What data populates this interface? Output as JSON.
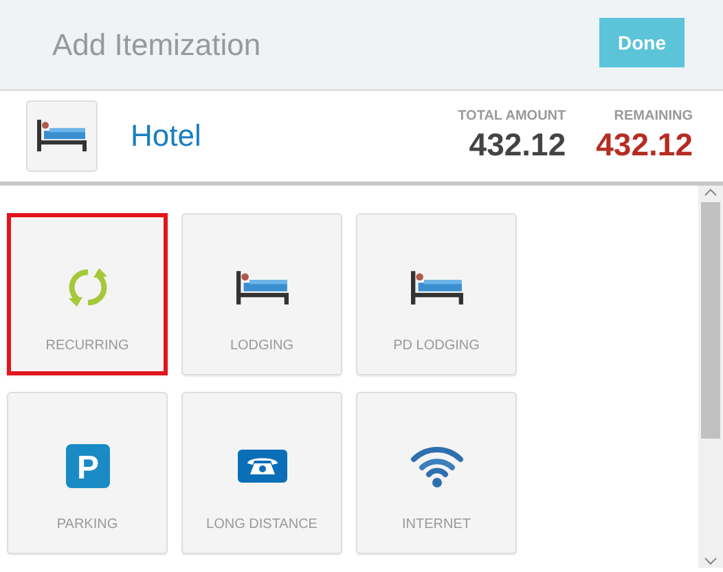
{
  "header": {
    "title": "Add Itemization",
    "done_button": "Done"
  },
  "expense": {
    "type": "Hotel",
    "total_amount_label": "TOTAL AMOUNT",
    "total_amount": "432.12",
    "remaining_label": "REMAINING",
    "remaining": "432.12"
  },
  "categories": [
    {
      "label": "RECURRING",
      "kind": "recurring",
      "selected": true
    },
    {
      "label": "LODGING",
      "kind": "lodging",
      "selected": false
    },
    {
      "label": "PD LODGING",
      "kind": "lodging",
      "selected": false
    },
    {
      "label": "PARKING",
      "kind": "parking",
      "icon_letter": "P",
      "selected": false
    },
    {
      "label": "LONG DISTANCE",
      "kind": "phone",
      "selected": false
    },
    {
      "label": "INTERNET",
      "kind": "internet",
      "selected": false
    }
  ]
}
